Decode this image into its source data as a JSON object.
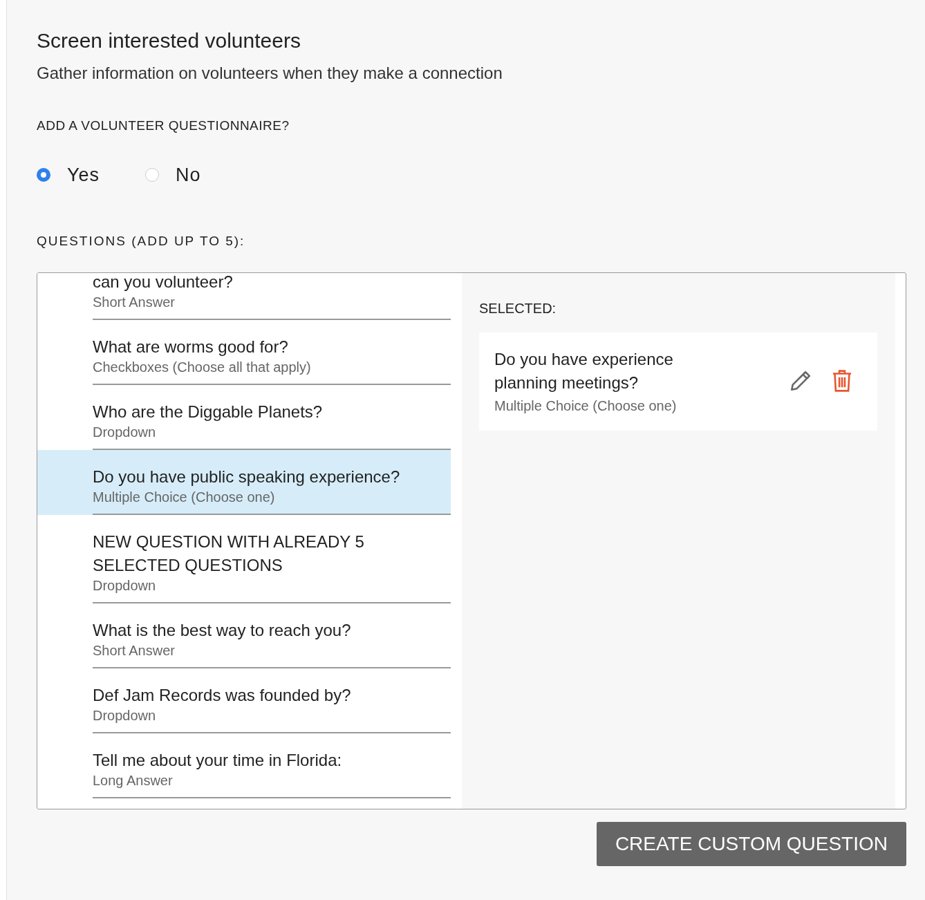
{
  "heading": "Screen interested volunteers",
  "subheading": "Gather information on volunteers when they make a connection",
  "questionnaire_label": "ADD A VOLUNTEER QUESTIONNAIRE?",
  "questionnaire_options": [
    {
      "label": "Yes",
      "selected": true
    },
    {
      "label": "No",
      "selected": false
    }
  ],
  "questions_label": "QUESTIONS (ADD UP TO 5):",
  "questions": [
    {
      "title": "can you volunteer?",
      "type": "Short Answer",
      "selected": false
    },
    {
      "title": "What are worms good for?",
      "type": "Checkboxes (Choose all that apply)",
      "selected": false
    },
    {
      "title": "Who are the Diggable Planets?",
      "type": "Dropdown",
      "selected": false
    },
    {
      "title": "Do you have public speaking experience?",
      "type": "Multiple Choice (Choose one)",
      "selected": true
    },
    {
      "title": "NEW QUESTION WITH ALREADY 5 SELECTED QUESTIONS",
      "type": "Dropdown",
      "selected": false
    },
    {
      "title": "What is the best way to reach you?",
      "type": "Short Answer",
      "selected": false
    },
    {
      "title": "Def Jam Records was founded by?",
      "type": "Dropdown",
      "selected": false
    },
    {
      "title": "Tell me about your time in Florida:",
      "type": "Long Answer",
      "selected": false
    }
  ],
  "selected_label": "SELECTED:",
  "selected_questions": [
    {
      "title": "Do you have experience planning meetings?",
      "type": "Multiple Choice (Choose one)"
    }
  ],
  "create_button": "CREATE CUSTOM QUESTION"
}
